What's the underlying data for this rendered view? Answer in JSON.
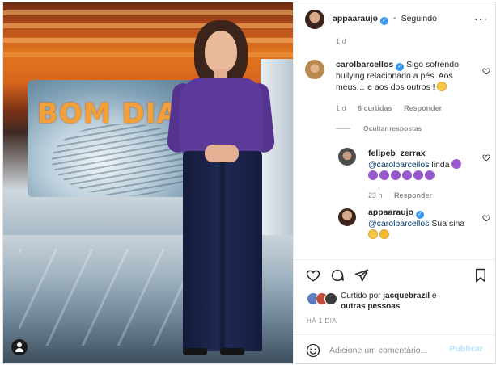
{
  "header": {
    "username": "appaaraujo",
    "separator": "•",
    "follow_status": "Seguindo"
  },
  "photo": {
    "studio_logo": "BOM DIA"
  },
  "top_meta": {
    "time": "1 d"
  },
  "comments": [
    {
      "username": "carolbarcellos",
      "text": "Sigo sofrendo bullying relacionado a pés. Aos meus… e aos dos outros !",
      "emoji": "surprised-face",
      "time": "1 d",
      "likes": "6 curtidas",
      "reply": "Responder",
      "hide_replies": "Ocultar respostas"
    },
    {
      "username": "felipeb_zerrax",
      "mention": "@carolbarcellos",
      "text": "linda",
      "emoji": "purple-heart",
      "emoji_count": 7,
      "time": "23 h",
      "reply": "Responder"
    },
    {
      "username": "appaaraujo",
      "mention": "@carolbarcellos",
      "text": "Sua sina",
      "emoji": "laughing-face"
    }
  ],
  "likes_summary": {
    "prefix": "Curtido por",
    "user": "jacquebrazil",
    "connector": "e",
    "suffix": "outras pessoas"
  },
  "post_time": "HÁ 1 DIA",
  "comment_box": {
    "placeholder": "Adicione um comentário...",
    "post_label": "Publicar"
  },
  "colors": {
    "verified": "#3897f0",
    "post_button_disabled": "#b2dffc",
    "mention": "#00376b"
  }
}
